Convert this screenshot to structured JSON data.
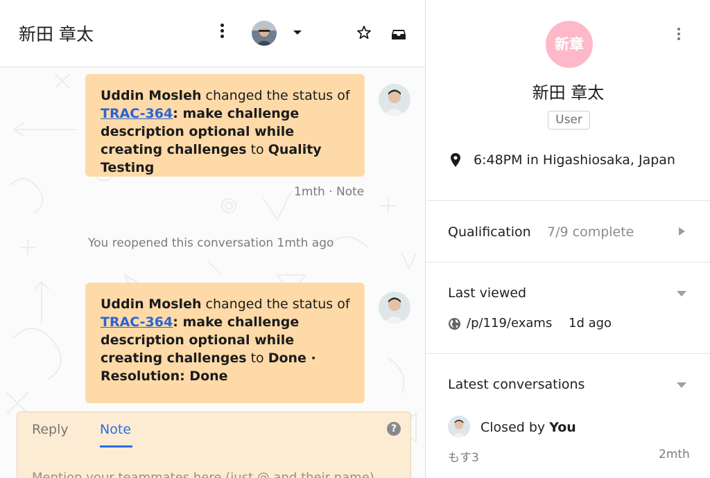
{
  "conversation": {
    "title": "新田 章太"
  },
  "feed": {
    "events": [
      {
        "actor": "Uddin Mosleh",
        "verb": " changed the status of ",
        "issue_key": "TRAC-364",
        "issue_title": ": make challenge description optional while creating challenges",
        "connector": " to ",
        "status": "Quality Testing"
      },
      {
        "actor": "Uddin Mosleh",
        "verb": " changed the status of ",
        "issue_key": "TRAC-364",
        "issue_title": ": make challenge description optional while creating challenges",
        "connector": " to ",
        "status": "Done · Resolution: Done"
      }
    ],
    "meta": "1mth · Note",
    "system_message": "You reopened this conversation 1mth ago"
  },
  "composer": {
    "tabs": [
      "Reply",
      "Note"
    ],
    "active_tab": "Note",
    "help": "?",
    "placeholder": "Mention your teammates here (just @ and their name)"
  },
  "user": {
    "initials": "新章",
    "name": "新田 章太",
    "role": "User",
    "local_time": "6:48PM in Higashiosaka, Japan",
    "avatar_color": "#ffb8c8"
  },
  "qualification": {
    "title": "Qualification",
    "progress": "7/9 complete"
  },
  "last_viewed": {
    "title": "Last viewed",
    "path": "/p/119/exams",
    "time": "1d ago"
  },
  "latest_conversations": {
    "title": "Latest conversations",
    "items": [
      {
        "status_prefix": "Closed by ",
        "status_actor": "You",
        "snippet": "もす3",
        "time": "2mth"
      }
    ]
  },
  "colors": {
    "bubble": "#fddaa8",
    "link": "#2a63d6",
    "tab_active": "#2a6ce3",
    "composer_bg": "#fdecd4"
  },
  "icons": [
    "kebab-icon",
    "chevron-down-icon",
    "star-icon",
    "inbox-icon",
    "help-icon",
    "location-pin-icon",
    "globe-icon",
    "chevron-right-icon"
  ]
}
